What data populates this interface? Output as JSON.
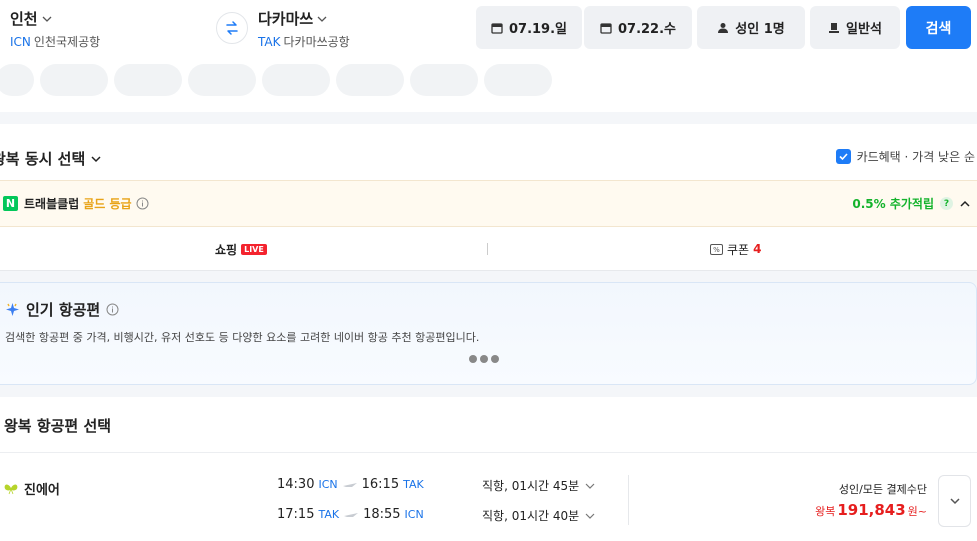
{
  "search": {
    "origin": {
      "name": "인천",
      "code": "ICN",
      "airport": "인천국제공항"
    },
    "destination": {
      "name": "다카마쓰",
      "code": "TAK",
      "airport": "다카마쓰공항"
    },
    "depart_date": "07.19.일",
    "return_date": "07.22.수",
    "passengers": "성인 1명",
    "cabin": "일반석",
    "search_label": "검색"
  },
  "filters": {
    "chip_count": 8
  },
  "results_header": {
    "title": "왕복 동시 선택",
    "sort_label": "카드혜택 · 가격 낮은 순"
  },
  "club": {
    "name": "트래블클럽",
    "grade": "골드 등급",
    "reward": "0.5% 추가적립",
    "help": "?"
  },
  "tabs": {
    "shopping": "쇼핑",
    "live": "LIVE",
    "coupon": "쿠폰",
    "coupon_count": "4"
  },
  "popular": {
    "title": "인기 항공편",
    "desc": "검색한 항공편 중 가격, 비행시간, 유저 선호도 등 다양한 요소를 고려한 네이버 항공 추천 항공편입니다."
  },
  "roundtrip": {
    "title": "왕복 항공편 선택",
    "flights": [
      {
        "airline": "진에어",
        "outbound": {
          "dep_time": "14:30",
          "dep_code": "ICN",
          "arr_time": "16:15",
          "arr_code": "TAK",
          "info": "직항, 01시간 45분"
        },
        "inbound": {
          "dep_time": "17:15",
          "dep_code": "TAK",
          "arr_time": "18:55",
          "arr_code": "ICN",
          "info": "직항, 01시간 40분"
        },
        "price_label": "성인/모든 결제수단",
        "price_prefix": "왕복",
        "price": "191,843",
        "price_suffix": "원~"
      }
    ]
  },
  "colors": {
    "accent": "#1e7cf7",
    "reward": "#14b32c",
    "gold": "#e8a317",
    "price": "#e61e1e"
  }
}
